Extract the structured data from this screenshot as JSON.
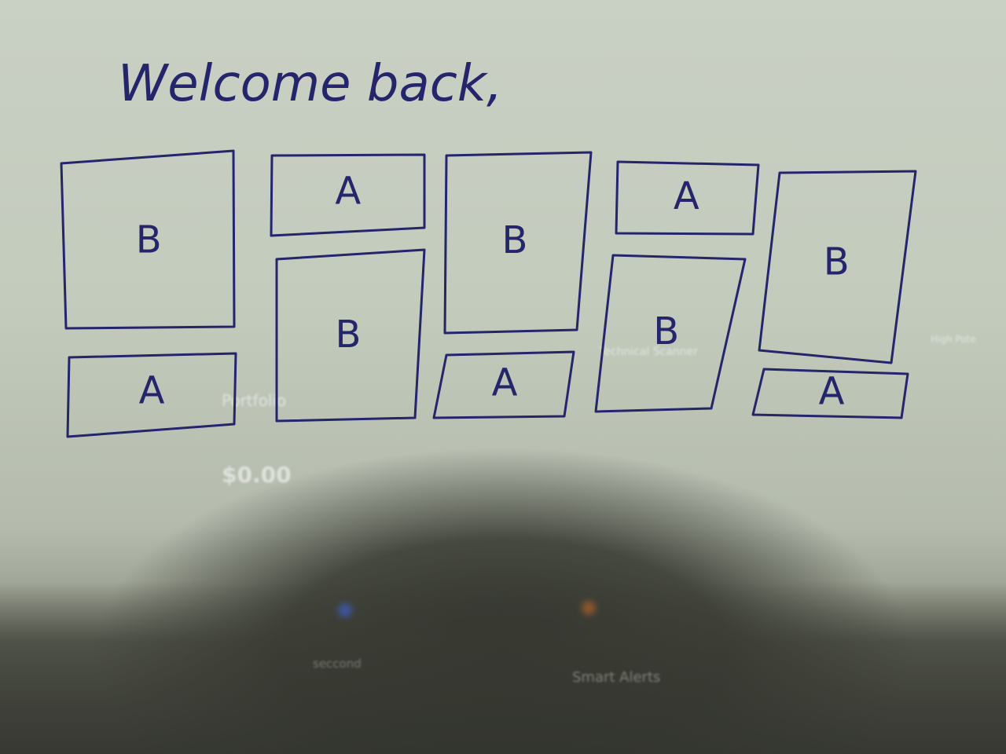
{
  "sketch": {
    "heading": "Welcome back,",
    "ink_color": "#24256b",
    "columns": [
      {
        "boxes": [
          "B",
          "A"
        ]
      },
      {
        "boxes": [
          "A",
          "B"
        ]
      },
      {
        "boxes": [
          "B",
          "A"
        ]
      },
      {
        "boxes": [
          "A",
          "B"
        ]
      },
      {
        "boxes": [
          "B",
          "A"
        ]
      }
    ]
  },
  "background_screen": {
    "portfolio_label": "Portfolio",
    "portfolio_value": "$0.00",
    "scanner_label": "Technical Scanner",
    "high_label": "High Pote",
    "smart_label": "Smart Alerts",
    "seccond_label": "seccond"
  }
}
